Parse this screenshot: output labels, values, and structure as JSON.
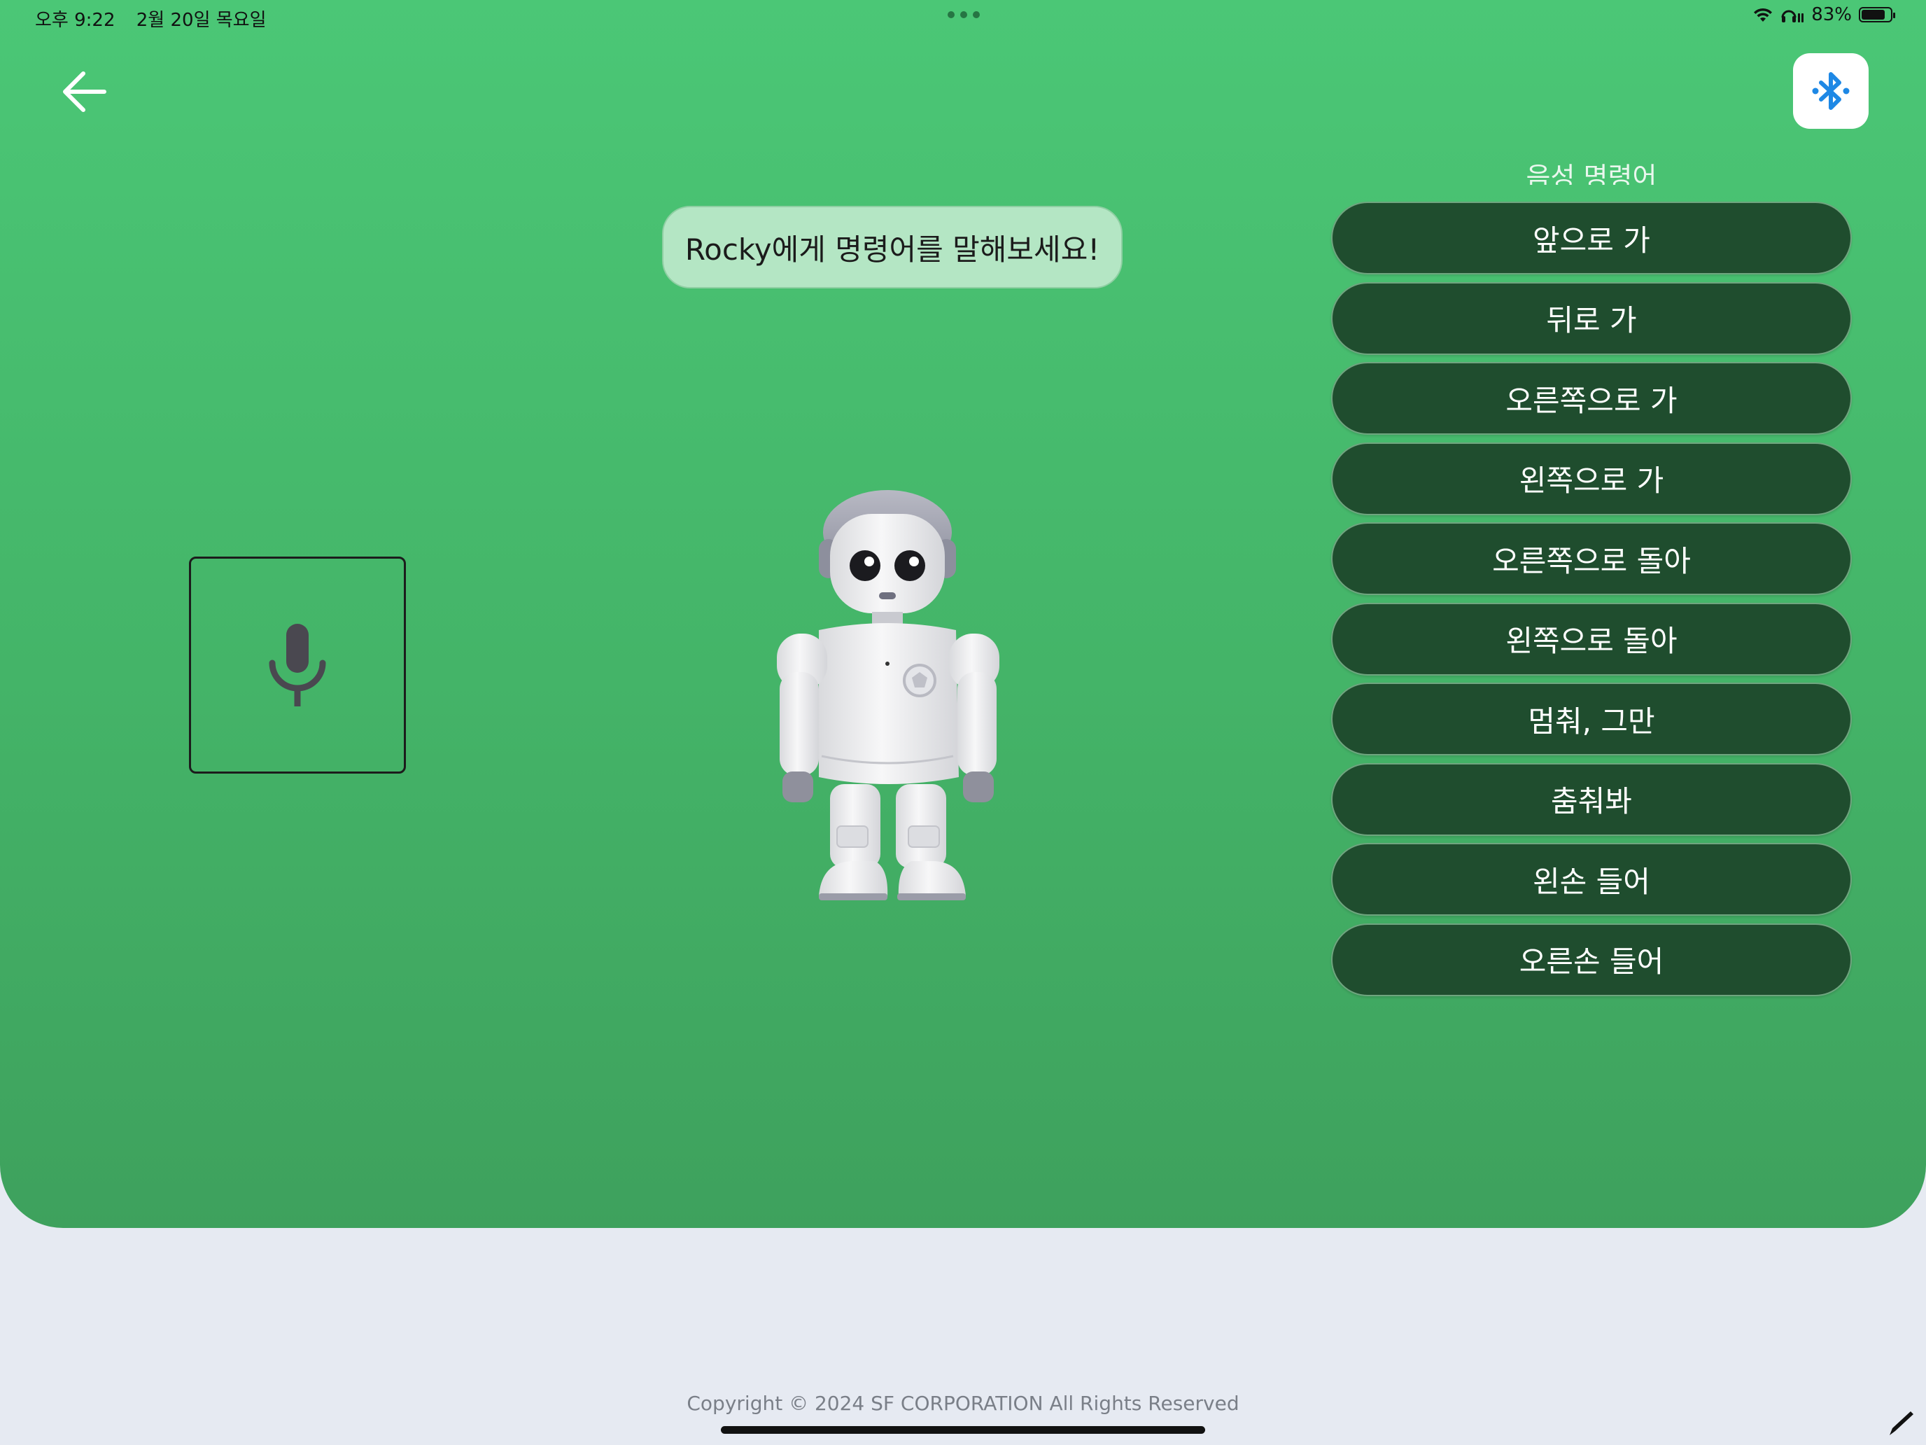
{
  "status_bar": {
    "time": "오후 9:22",
    "date": "2월 20일 목요일",
    "battery": "83%",
    "battery_level": 0.83
  },
  "header": {
    "back_icon": "arrow-left-icon",
    "bluetooth_icon": "bluetooth-icon",
    "bluetooth_color": "#1e88e5"
  },
  "prompt": {
    "text": "Rocky에게 명령어를 말해보세요!"
  },
  "mic": {
    "icon": "microphone-icon"
  },
  "commands": {
    "title": "음성 명령어",
    "items": [
      "앞으로 가",
      "뒤로 가",
      "오른쪽으로 가",
      "왼쪽으로 가",
      "오른쪽으로 돌아",
      "왼쪽으로 돌아",
      "멈춰, 그만",
      "춤춰봐",
      "왼손 들어",
      "오른손 들어"
    ]
  },
  "footer": {
    "copyright": "Copyright © 2024 SF CORPORATION All Rights Reserved"
  },
  "colors": {
    "panel_green": "#44b468",
    "button_dark_green": "#1f4d2e",
    "bubble_green": "#b4e6c4",
    "background": "#e6eaf2"
  }
}
